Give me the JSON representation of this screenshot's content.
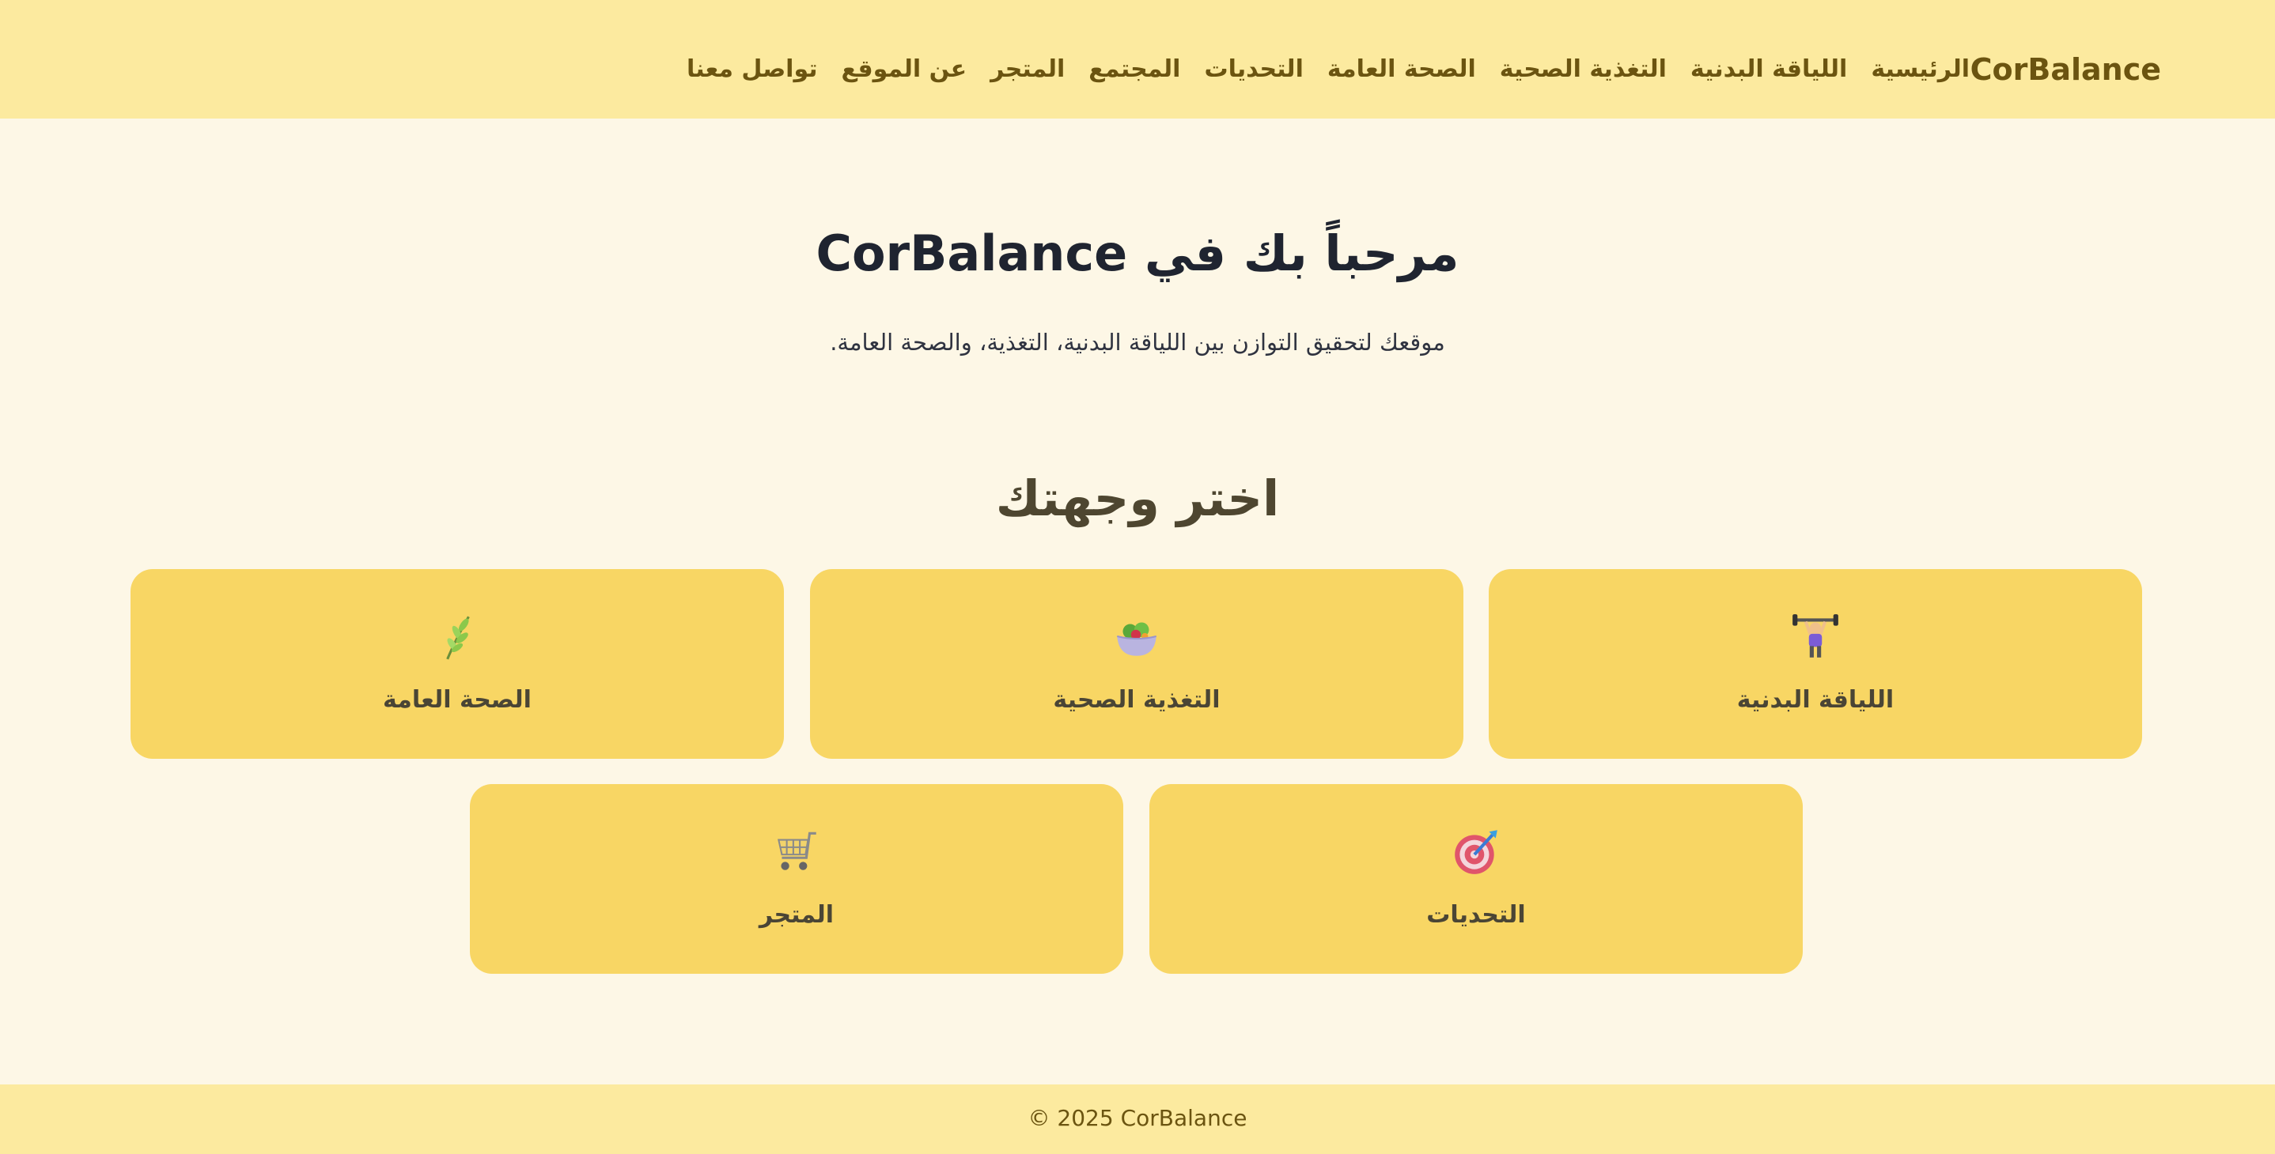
{
  "header": {
    "brand": "CorBalance",
    "nav": [
      "الرئيسية",
      "اللياقة البدنية",
      "التغذية الصحية",
      "الصحة العامة",
      "التحديات",
      "المجتمع",
      "المتجر",
      "عن الموقع",
      "تواصل معنا"
    ]
  },
  "hero": {
    "title": "مرحباً بك في CorBalance",
    "subtitle": "موقعك لتحقيق التوازن بين اللياقة البدنية، التغذية، والصحة العامة."
  },
  "destinations": {
    "title": "اختر وجهتك",
    "cards": [
      {
        "label": "اللياقة البدنية",
        "icon": "weightlifter-icon"
      },
      {
        "label": "التغذية الصحية",
        "icon": "salad-bowl-icon"
      },
      {
        "label": "الصحة العامة",
        "icon": "herb-icon"
      },
      {
        "label": "التحديات",
        "icon": "target-icon"
      },
      {
        "label": "المتجر",
        "icon": "shopping-cart-icon"
      }
    ]
  },
  "footer": {
    "text": "© 2025 CorBalance"
  },
  "colors": {
    "header_bg": "#fcea9f",
    "page_bg": "#fdf7e6",
    "card_bg": "#f8d664",
    "brand_text": "#6b5410"
  }
}
